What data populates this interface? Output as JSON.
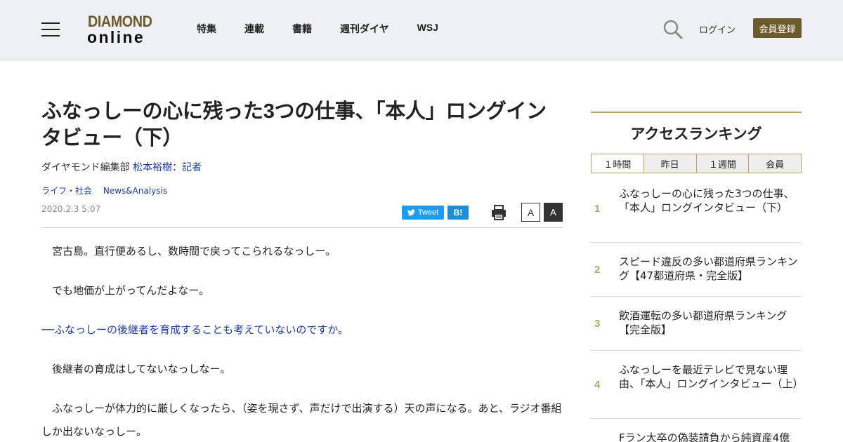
{
  "header": {
    "logo_top": "DIAMOND",
    "logo_bottom": "online",
    "nav": [
      "特集",
      "連載",
      "書籍",
      "週刊ダイヤ",
      "WSJ"
    ],
    "login": "ログイン",
    "register": "会員登録"
  },
  "article": {
    "title": "ふなっしーの心に残った3つの仕事、「本人」ロングインタビュー（下）",
    "byline_prefix": "ダイヤモンド編集部",
    "author": "松本裕樹：記者",
    "tags": [
      "ライフ・社会",
      "News&Analysis"
    ],
    "date": "2020.2.3 5:07",
    "tweet_label": "Tweet",
    "hatena_label": "B!",
    "font_small": "A",
    "font_large": "A",
    "paragraphs": [
      "　宮古島。直行便あるし、数時間で戻ってこられるなっしー。",
      "　でも地価が上がってんだよなー。",
      "──ふなっしーの後継者を育成することも考えていないのですか。",
      "　後継者の育成はしてないなっしなー。",
      "　ふなっしーが体力的に厳しくなったら、（姿を現さず、声だけで出演する）天の声になる。あと、ラジオ番組しか出ないなっしー。"
    ]
  },
  "sidebar": {
    "title": "アクセスランキング",
    "tabs": [
      "１時間",
      "昨日",
      "１週間",
      "会員"
    ],
    "ranking": [
      {
        "rank": "1",
        "text": "ふなっしーの心に残った3つの仕事、「本人」ロングインタビュー（下）"
      },
      {
        "rank": "2",
        "text": "スピード違反の多い都道府県ランキング【47都道府県・完全版】"
      },
      {
        "rank": "3",
        "text": "飲酒運転の多い都道府県ランキング【完全版】"
      },
      {
        "rank": "4",
        "text": "ふなっしーを最近テレビで見ない理由、「本人」ロングインタビュー（上）"
      },
      {
        "rank": "",
        "text": "Fラン大卒の偽装請負から純資産4億"
      }
    ]
  },
  "colors": {
    "brand_gold": "#6b5a2c",
    "rank_gold": "#b8a46a",
    "link_blue": "#1a3aa0",
    "twitter_blue": "#1d9bf0"
  },
  "icons": [
    "menu-icon",
    "search-icon",
    "twitter-bird-icon",
    "print-icon"
  ]
}
